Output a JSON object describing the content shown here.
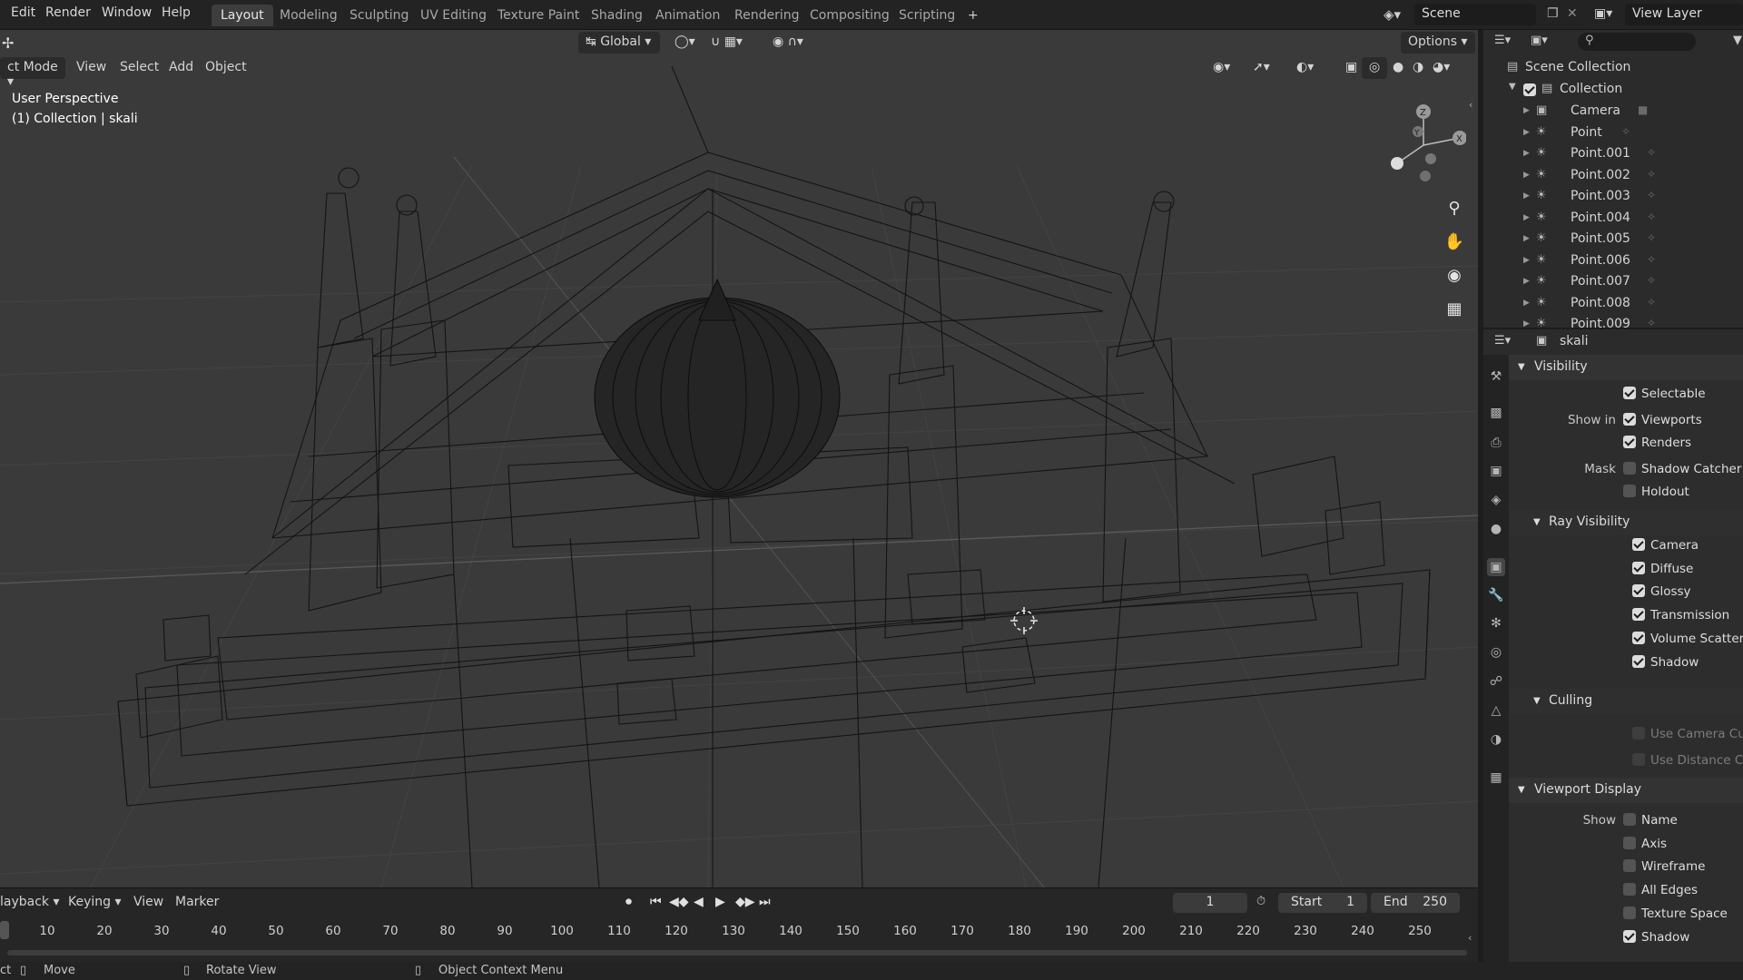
{
  "topbar": {
    "menus": [
      "Edit",
      "Render",
      "Window",
      "Help"
    ],
    "workspaces": [
      "Layout",
      "Modeling",
      "Sculpting",
      "UV Editing",
      "Texture Paint",
      "Shading",
      "Animation",
      "Rendering",
      "Compositing",
      "Scripting"
    ],
    "active_workspace": "Layout",
    "add_tab": "+",
    "scene": "Scene",
    "view_layer": "View Layer"
  },
  "viewport": {
    "mode": "ct Mode",
    "menus": [
      "View",
      "Select",
      "Add",
      "Object"
    ],
    "transform_orientation": "Global",
    "options": "Options",
    "perspective_label": "User Perspective",
    "collection_label": "(1) Collection | skali",
    "gizmo_axes": [
      "Z",
      "Y",
      "X"
    ],
    "shading_mode": "wireframe"
  },
  "outliner": {
    "scene_collection": "Scene Collection",
    "collection": "Collection",
    "objects": [
      "Camera",
      "Point",
      "Point.001",
      "Point.002",
      "Point.003",
      "Point.004",
      "Point.005",
      "Point.006",
      "Point.007",
      "Point.008",
      "Point.009"
    ]
  },
  "properties": {
    "object_name": "skali",
    "visibility": {
      "title": "Visibility",
      "selectable": "Selectable",
      "show_in_label": "Show in",
      "viewports": "Viewports",
      "renders": "Renders",
      "mask_label": "Mask",
      "shadow_catcher": "Shadow Catcher",
      "holdout": "Holdout"
    },
    "ray_visibility": {
      "title": "Ray Visibility",
      "items": [
        "Camera",
        "Diffuse",
        "Glossy",
        "Transmission",
        "Volume Scatter",
        "Shadow"
      ]
    },
    "culling": {
      "title": "Culling",
      "items": [
        "Use Camera Cull",
        "Use Distance Cull"
      ]
    },
    "viewport_display": {
      "title": "Viewport Display",
      "show_label": "Show",
      "items": [
        "Name",
        "Axis",
        "Wireframe",
        "All Edges",
        "Texture Space",
        "Shadow"
      ],
      "checked": [
        false,
        false,
        false,
        false,
        false,
        true
      ]
    }
  },
  "timeline": {
    "menus": [
      "layback",
      "Keying",
      "View",
      "Marker"
    ],
    "current_frame": "1",
    "start_label": "Start",
    "start": "1",
    "end_label": "End",
    "end": "250",
    "ruler": [
      "10",
      "20",
      "30",
      "40",
      "50",
      "60",
      "70",
      "80",
      "90",
      "100",
      "110",
      "120",
      "130",
      "140",
      "150",
      "160",
      "170",
      "180",
      "190",
      "200",
      "210",
      "220",
      "230",
      "240",
      "250"
    ]
  },
  "statusbar": {
    "left_fragment": "ct",
    "move": "Move",
    "rotate": "Rotate View",
    "context_menu": "Object Context Menu"
  },
  "colors": {
    "accent_active_tab": "#3d3d3d",
    "checkbox_on": "#dcdcdc",
    "viewport_bg": "#3a3a3a"
  }
}
